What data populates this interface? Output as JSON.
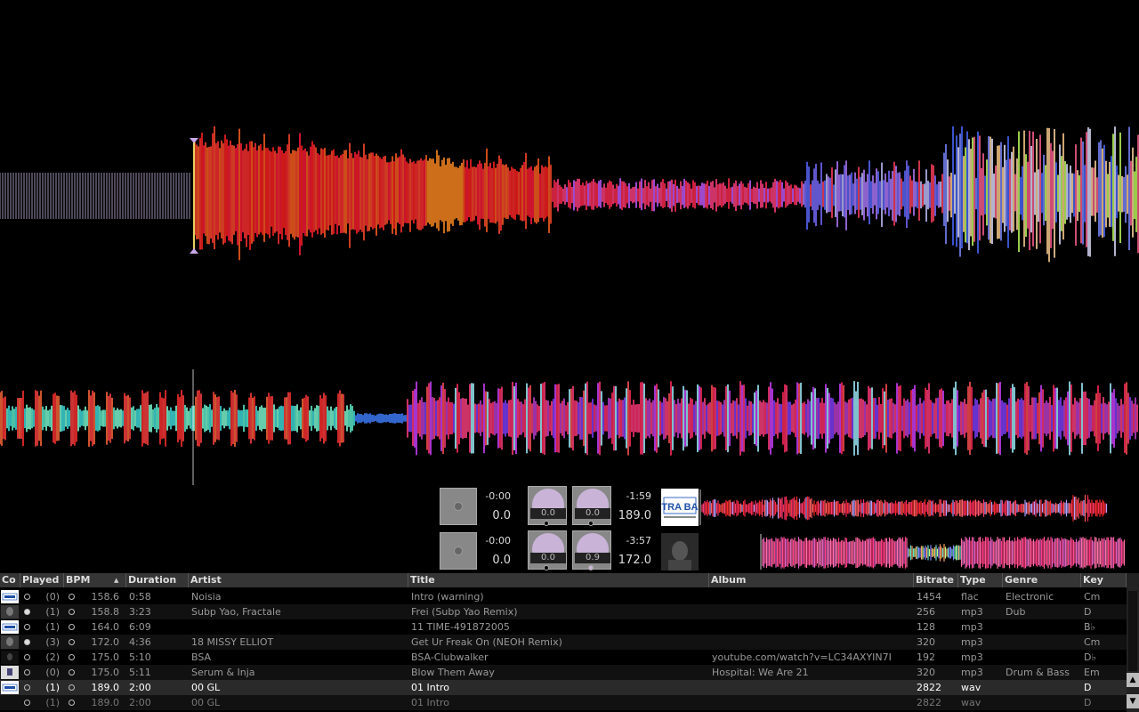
{
  "colors": {
    "background": "#000000",
    "header_bg": "#353535",
    "row_alt": "#111111",
    "row_selected": "#2a2a2a"
  },
  "deck1": {
    "elapsed": "-0:00",
    "bpm": "0.0",
    "gain_left": "0.0",
    "gain_right": "0.0",
    "remaining": "-1:59",
    "track_bpm": "189.0",
    "cover_label": "EXTRA BASS"
  },
  "deck2": {
    "elapsed": "-0:00",
    "bpm": "0.0",
    "gain_left": "0.0",
    "gain_right": "0.9",
    "remaining": "-3:57",
    "track_bpm": "172.0"
  },
  "library": {
    "columns": [
      "Co",
      "Played",
      "BPM",
      "Duration",
      "Artist",
      "Title",
      "Album",
      "Bitrate",
      "Type",
      "Genre",
      "Key"
    ],
    "sort_indicator": "▲",
    "rows": [
      {
        "cover": "bass",
        "played": "(0)",
        "played_on": false,
        "bpm": "158.6",
        "duration": "0:58",
        "artist": "Noisia",
        "title": "Intro (warning)",
        "album": "",
        "bitrate": "1454",
        "type": "flac",
        "genre": "Electronic",
        "key": "Cm"
      },
      {
        "cover": "dark",
        "played": "(1)",
        "played_on": true,
        "bpm": "158.8",
        "duration": "3:23",
        "artist": "Subp Yao, Fractale",
        "title": "Frei (Subp Yao Remix)",
        "album": "",
        "bitrate": "256",
        "type": "mp3",
        "genre": "Dub",
        "key": "D"
      },
      {
        "cover": "bass",
        "played": "(1)",
        "played_on": false,
        "bpm": "164.0",
        "duration": "6:09",
        "artist": "",
        "title": "11 TIME-491872005",
        "album": "",
        "bitrate": "128",
        "type": "mp3",
        "genre": "",
        "key": "B♭"
      },
      {
        "cover": "dark",
        "played": "(3)",
        "played_on": true,
        "bpm": "172.0",
        "duration": "4:36",
        "artist": "18 MISSY ELLIOT",
        "title": "Get Ur Freak On (NEOH Remix)",
        "album": "",
        "bitrate": "320",
        "type": "mp3",
        "genre": "",
        "key": "Cm"
      },
      {
        "cover": "dark2",
        "played": "(2)",
        "played_on": false,
        "bpm": "175.0",
        "duration": "5:10",
        "artist": "BSA",
        "title": "BSA-Clubwalker",
        "album": "youtube.com/watch?v=LC34AXYIN7I",
        "bitrate": "192",
        "type": "mp3",
        "genre": "",
        "key": "D♭"
      },
      {
        "cover": "light",
        "played": "(0)",
        "played_on": false,
        "bpm": "175.0",
        "duration": "5:11",
        "artist": "Serum & Inja",
        "title": "Blow Them Away",
        "album": "Hospital: We Are 21",
        "bitrate": "320",
        "type": "mp3",
        "genre": "Drum & Bass",
        "key": "Em"
      },
      {
        "cover": "bass",
        "played": "(1)",
        "played_on": false,
        "bpm": "189.0",
        "duration": "2:00",
        "artist": "00 GL",
        "title": "01 Intro",
        "album": "",
        "bitrate": "2822",
        "type": "wav",
        "genre": "",
        "key": "D"
      },
      {
        "cover": "",
        "played": "(1)",
        "played_on": false,
        "bpm": "189.0",
        "duration": "2:00",
        "artist": "00 GL",
        "title": "01 Intro",
        "album": "",
        "bitrate": "2822",
        "type": "wav",
        "genre": "",
        "key": "D"
      }
    ]
  },
  "scroll": {
    "up_icon": "▲",
    "down_icon": "▼"
  }
}
